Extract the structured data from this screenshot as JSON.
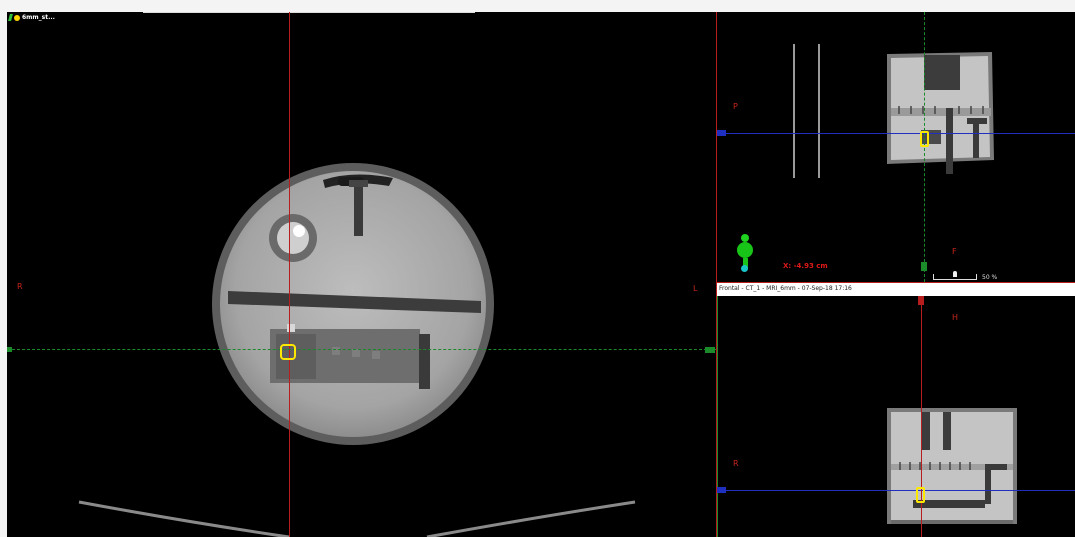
{
  "main_view": {
    "series_tag": "6mm_st...",
    "orientation_left": "R",
    "orientation_right": "L"
  },
  "sagittal_view": {
    "orientation_top": "P",
    "orientation_bottom": "F",
    "x_readout": "X: -4.93 cm",
    "zoom": "50 %"
  },
  "frontal_view": {
    "header": "Frontal - CT_1 - MRI_6mm - 07-Sep-18 17:16",
    "orientation_top": "H",
    "orientation_left": "R"
  },
  "colors": {
    "crosshair_red": "#b81d1d",
    "crosshair_green": "#1a8a2a",
    "crosshair_blue": "#1f2fbf",
    "roi_yellow": "#ffe800",
    "label_red": "#c8261c"
  }
}
